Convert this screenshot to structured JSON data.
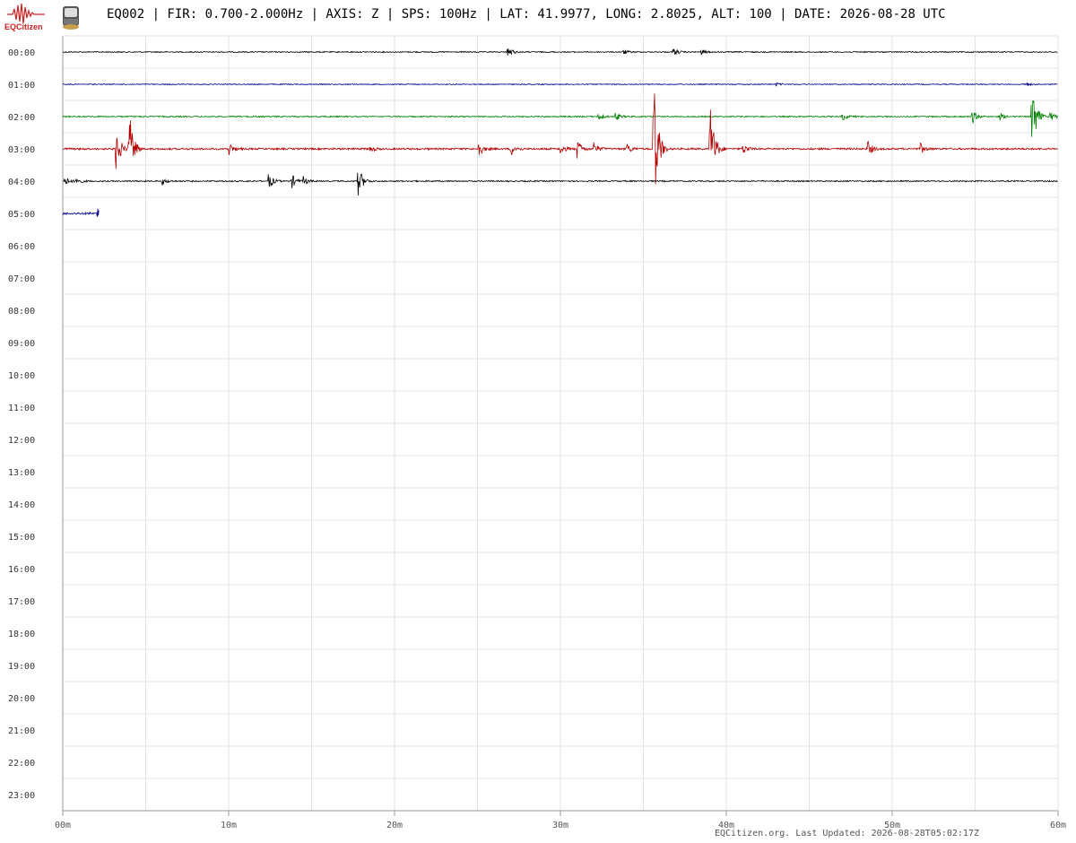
{
  "header": {
    "logo_text": "EQCitizen",
    "title": "EQ002 | FIR: 0.700-2.000Hz | AXIS: Z | SPS: 100Hz | LAT: 41.9977, LONG: 2.8025, ALT: 100 | DATE: 2026-08-28 UTC",
    "logo_icon": "seismogram-logo-icon",
    "sensor_icon": "sensor-device-icon"
  },
  "footer": {
    "text": "EQCitizen.org. Last Updated: 2026-08-28T05:02:17Z"
  },
  "chart_data": {
    "type": "line",
    "title": "EQ002 | FIR: 0.700-2.000Hz | AXIS: Z | SPS: 100Hz | LAT: 41.9977, LONG: 2.8025, ALT: 100 | DATE: 2026-08-28 UTC",
    "xlabel": "",
    "ylabel": "",
    "grid": true,
    "x_range": [
      0,
      60
    ],
    "x_ticks": [
      {
        "value": 0,
        "label": "00m"
      },
      {
        "value": 10,
        "label": "10m"
      },
      {
        "value": 20,
        "label": "20m"
      },
      {
        "value": 30,
        "label": "30m"
      },
      {
        "value": 40,
        "label": "40m"
      },
      {
        "value": 50,
        "label": "50m"
      },
      {
        "value": 60,
        "label": "60m"
      }
    ],
    "hour_labels": [
      "00:00",
      "01:00",
      "02:00",
      "03:00",
      "04:00",
      "05:00",
      "06:00",
      "07:00",
      "08:00",
      "09:00",
      "10:00",
      "11:00",
      "12:00",
      "13:00",
      "14:00",
      "15:00",
      "16:00",
      "17:00",
      "18:00",
      "19:00",
      "20:00",
      "21:00",
      "22:00",
      "23:00"
    ],
    "color_cycle": [
      "#000000",
      "#00008b",
      "#008000",
      "#b00000"
    ],
    "series": [
      {
        "hour": "00:00",
        "color": "#000000",
        "end_minute": 60,
        "noise": 0.6,
        "events": [
          {
            "minute": 26.8,
            "amp": 8
          },
          {
            "minute": 36.8,
            "amp": 5
          },
          {
            "minute": 33.8,
            "amp": 3
          },
          {
            "minute": 38.5,
            "amp": 3
          }
        ]
      },
      {
        "hour": "01:00",
        "color": "#00008b",
        "end_minute": 60,
        "noise": 0.5,
        "events": [
          {
            "minute": 58.0,
            "amp": 3
          },
          {
            "minute": 43.0,
            "amp": 2
          }
        ]
      },
      {
        "hour": "02:00",
        "color": "#008000",
        "end_minute": 60,
        "noise": 0.7,
        "events": [
          {
            "minute": 32.3,
            "amp": 6
          },
          {
            "minute": 33.3,
            "amp": 5
          },
          {
            "minute": 47.0,
            "amp": 5
          },
          {
            "minute": 54.8,
            "amp": 9
          },
          {
            "minute": 56.5,
            "amp": 4
          },
          {
            "minute": 58.4,
            "amp": 48
          },
          {
            "minute": 59.5,
            "amp": 6
          }
        ]
      },
      {
        "hour": "03:00",
        "color": "#b00000",
        "end_minute": 60,
        "noise": 1.0,
        "events": [
          {
            "minute": 3.2,
            "amp": 30
          },
          {
            "minute": 4.0,
            "amp": 45
          },
          {
            "minute": 10.0,
            "amp": 8
          },
          {
            "minute": 18.5,
            "amp": 4
          },
          {
            "minute": 25.0,
            "amp": 12
          },
          {
            "minute": 27.0,
            "amp": 8
          },
          {
            "minute": 30.0,
            "amp": 6
          },
          {
            "minute": 31.0,
            "amp": 12
          },
          {
            "minute": 32.0,
            "amp": 7
          },
          {
            "minute": 34.0,
            "amp": 6
          },
          {
            "minute": 35.6,
            "amp": 90
          },
          {
            "minute": 39.0,
            "amp": 60
          },
          {
            "minute": 41.0,
            "amp": 6
          },
          {
            "minute": 48.5,
            "amp": 10
          },
          {
            "minute": 51.7,
            "amp": 6
          }
        ]
      },
      {
        "hour": "04:00",
        "color": "#000000",
        "end_minute": 60,
        "noise": 0.7,
        "events": [
          {
            "minute": 0.1,
            "amp": 6
          },
          {
            "minute": 0.8,
            "amp": 5
          },
          {
            "minute": 6.0,
            "amp": 4
          },
          {
            "minute": 12.4,
            "amp": 10
          },
          {
            "minute": 13.8,
            "amp": 8
          },
          {
            "minute": 14.5,
            "amp": 5
          },
          {
            "minute": 17.8,
            "amp": 20
          }
        ]
      },
      {
        "hour": "05:00",
        "color": "#00008b",
        "end_minute": 2.2,
        "noise": 1.2,
        "events": [
          {
            "minute": 2.1,
            "amp": 6
          }
        ]
      }
    ]
  }
}
